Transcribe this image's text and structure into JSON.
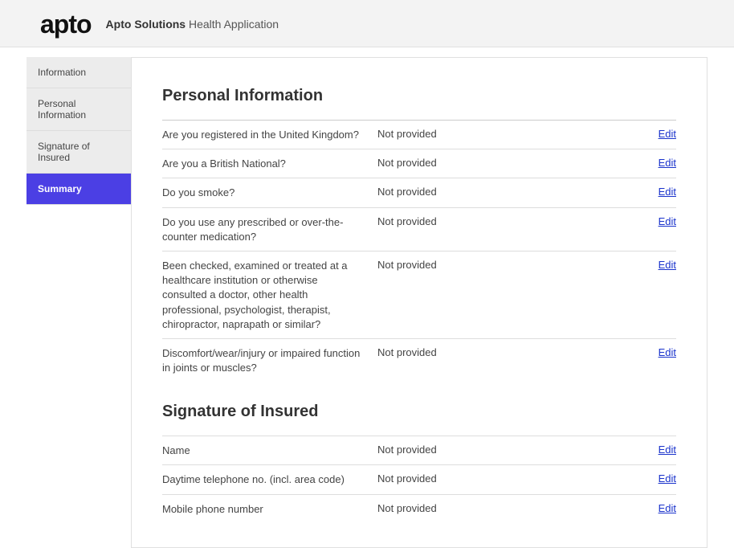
{
  "header": {
    "logo": "apto",
    "title_bold": "Apto Solutions",
    "title_rest": "Health Application"
  },
  "sidebar": {
    "items": [
      {
        "label": "Information",
        "active": false
      },
      {
        "label": "Personal Information",
        "active": false
      },
      {
        "label": "Signature of Insured",
        "active": false
      },
      {
        "label": "Summary",
        "active": true
      }
    ]
  },
  "sections": [
    {
      "title": "Personal Information",
      "rows": [
        {
          "question": "Are you registered in the United Kingdom?",
          "answer": "Not provided",
          "edit": "Edit"
        },
        {
          "question": "Are you a British National?",
          "answer": "Not provided",
          "edit": "Edit"
        },
        {
          "question": "Do you smoke?",
          "answer": "Not provided",
          "edit": "Edit"
        },
        {
          "question": "Do you use any prescribed or over-the-counter medication?",
          "answer": "Not provided",
          "edit": "Edit"
        },
        {
          "question": "Been checked, examined or treated at a healthcare institution or otherwise consulted a doctor, other health professional, psychologist, therapist, chiropractor, naprapath or similar?",
          "answer": "Not provided",
          "edit": "Edit"
        },
        {
          "question": "Discomfort/wear/injury or impaired function in joints or muscles?",
          "answer": "Not provided",
          "edit": "Edit"
        }
      ]
    },
    {
      "title": "Signature of Insured",
      "rows": [
        {
          "question": "Name",
          "answer": "Not provided",
          "edit": "Edit"
        },
        {
          "question": "Daytime telephone no. (incl. area code)",
          "answer": "Not provided",
          "edit": "Edit"
        },
        {
          "question": "Mobile phone number",
          "answer": "Not provided",
          "edit": "Edit"
        }
      ]
    }
  ]
}
